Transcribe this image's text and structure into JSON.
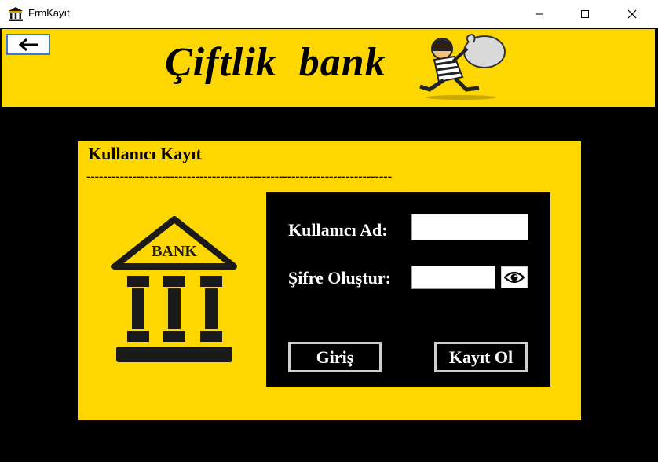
{
  "window": {
    "title": "FrmKayıt",
    "app_icon": "bank-building-icon",
    "controls": {
      "minimize": "minimize-icon",
      "maximize": "maximize-icon",
      "close": "close-icon"
    }
  },
  "header": {
    "brand_text": "Çiftlik  bank",
    "back_icon": "arrow-left-icon",
    "illustration": "thief-with-money-bag-icon",
    "background_color": "#FFD700"
  },
  "panel": {
    "title": "Kullanıcı Kayıt",
    "divider": "-------------------------------------------------------------------------",
    "logo_text": "BANK"
  },
  "form": {
    "username_label": "Kullanıcı Ad:",
    "username_value": "",
    "password_label": "Şifre Oluştur:",
    "password_value": "",
    "show_password_icon": "eye-icon",
    "login_button": "Giriş",
    "register_button": "Kayıt Ol"
  }
}
